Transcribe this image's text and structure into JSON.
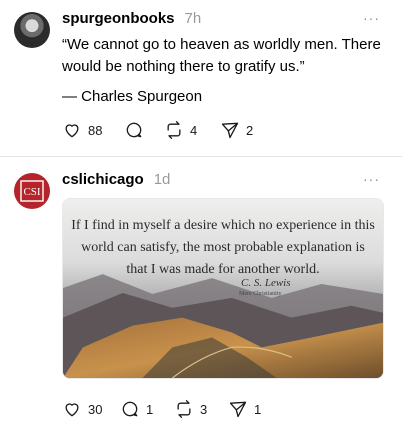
{
  "posts": [
    {
      "username": "spurgeonbooks",
      "time": "7h",
      "more": "···",
      "quote": "“We cannot go to heaven as worldly men. There would be nothing there to gratify us.”",
      "attribution": "— Charles Spurgeon",
      "actions": {
        "likes": "88",
        "reposts": "4",
        "shares": "2"
      },
      "icons": [
        "heart-icon",
        "comment-icon",
        "repost-icon",
        "share-icon"
      ]
    },
    {
      "username": "cslichicago",
      "time": "1d",
      "more": "···",
      "avatar_text": "CSI",
      "media": {
        "quote": "If I find in myself a desire which no experience in this world can satisfy, the most probable explanation is that I was made for another world.",
        "signature": "C. S. Lewis",
        "signature_sub": "Mere Christianity"
      },
      "actions": {
        "likes": "30",
        "comments": "1",
        "reposts": "3",
        "shares": "1"
      },
      "colors": {
        "avatar_bg": "#b3242b"
      }
    }
  ]
}
